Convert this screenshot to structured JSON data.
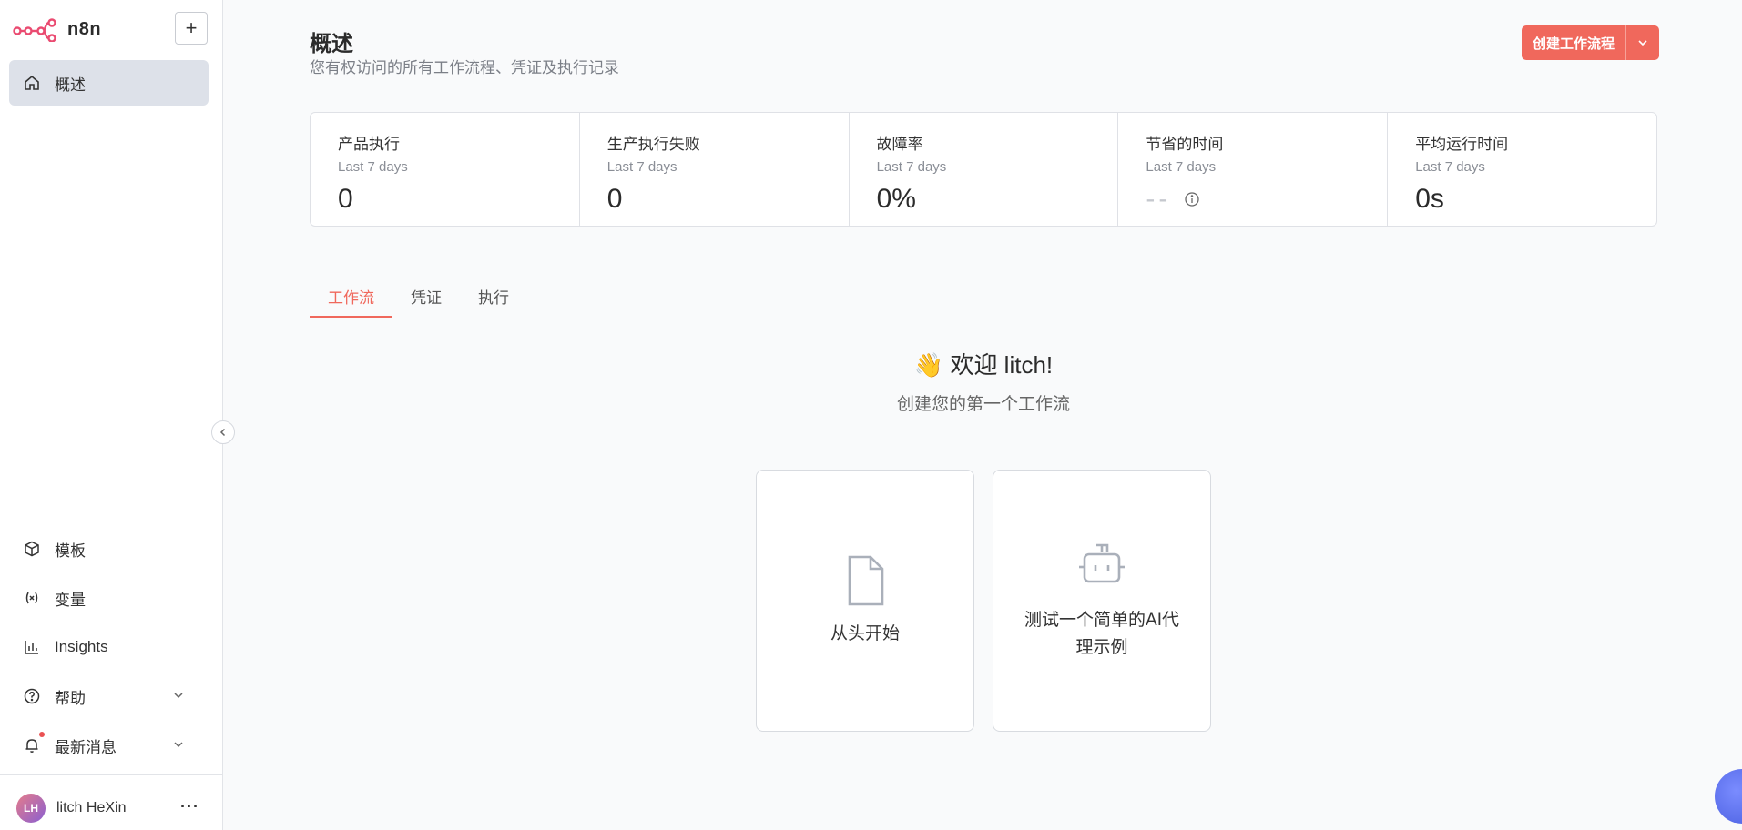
{
  "brand": {
    "name": "n8n"
  },
  "sidebar": {
    "add_label": "+",
    "top_items": [
      {
        "label": "概述",
        "icon": "home-icon"
      }
    ],
    "bottom_items": [
      {
        "label": "模板",
        "icon": "box-icon"
      },
      {
        "label": "变量",
        "icon": "variable-icon"
      },
      {
        "label": "Insights",
        "icon": "chart-icon"
      },
      {
        "label": "帮助",
        "icon": "help-icon"
      },
      {
        "label": "最新消息",
        "icon": "bell-icon"
      }
    ],
    "user": {
      "initials": "LH",
      "name": "litch HeXin",
      "more": "···"
    }
  },
  "header": {
    "title": "概述",
    "subtitle": "您有权访问的所有工作流程、凭证及执行记录",
    "create_label": "创建工作流程"
  },
  "stats": [
    {
      "label": "产品执行",
      "period": "Last 7 days",
      "value": "0"
    },
    {
      "label": "生产执行失败",
      "period": "Last 7 days",
      "value": "0"
    },
    {
      "label": "故障率",
      "period": "Last 7 days",
      "value": "0%"
    },
    {
      "label": "节省的时间",
      "period": "Last 7 days",
      "value": "--"
    },
    {
      "label": "平均运行时间",
      "period": "Last 7 days",
      "value": "0s"
    }
  ],
  "tabs": [
    {
      "label": "工作流",
      "active": true
    },
    {
      "label": "凭证",
      "active": false
    },
    {
      "label": "执行",
      "active": false
    }
  ],
  "welcome": {
    "title": "👋 欢迎 litch!",
    "subtitle": "创建您的第一个工作流"
  },
  "cards": [
    {
      "label": "从头开始",
      "icon": "file-icon"
    },
    {
      "label": "测试一个简单的AI代理示例",
      "icon": "robot-icon"
    }
  ],
  "colors": {
    "accent": "#f0685c",
    "active_nav": "#dde1e9"
  }
}
